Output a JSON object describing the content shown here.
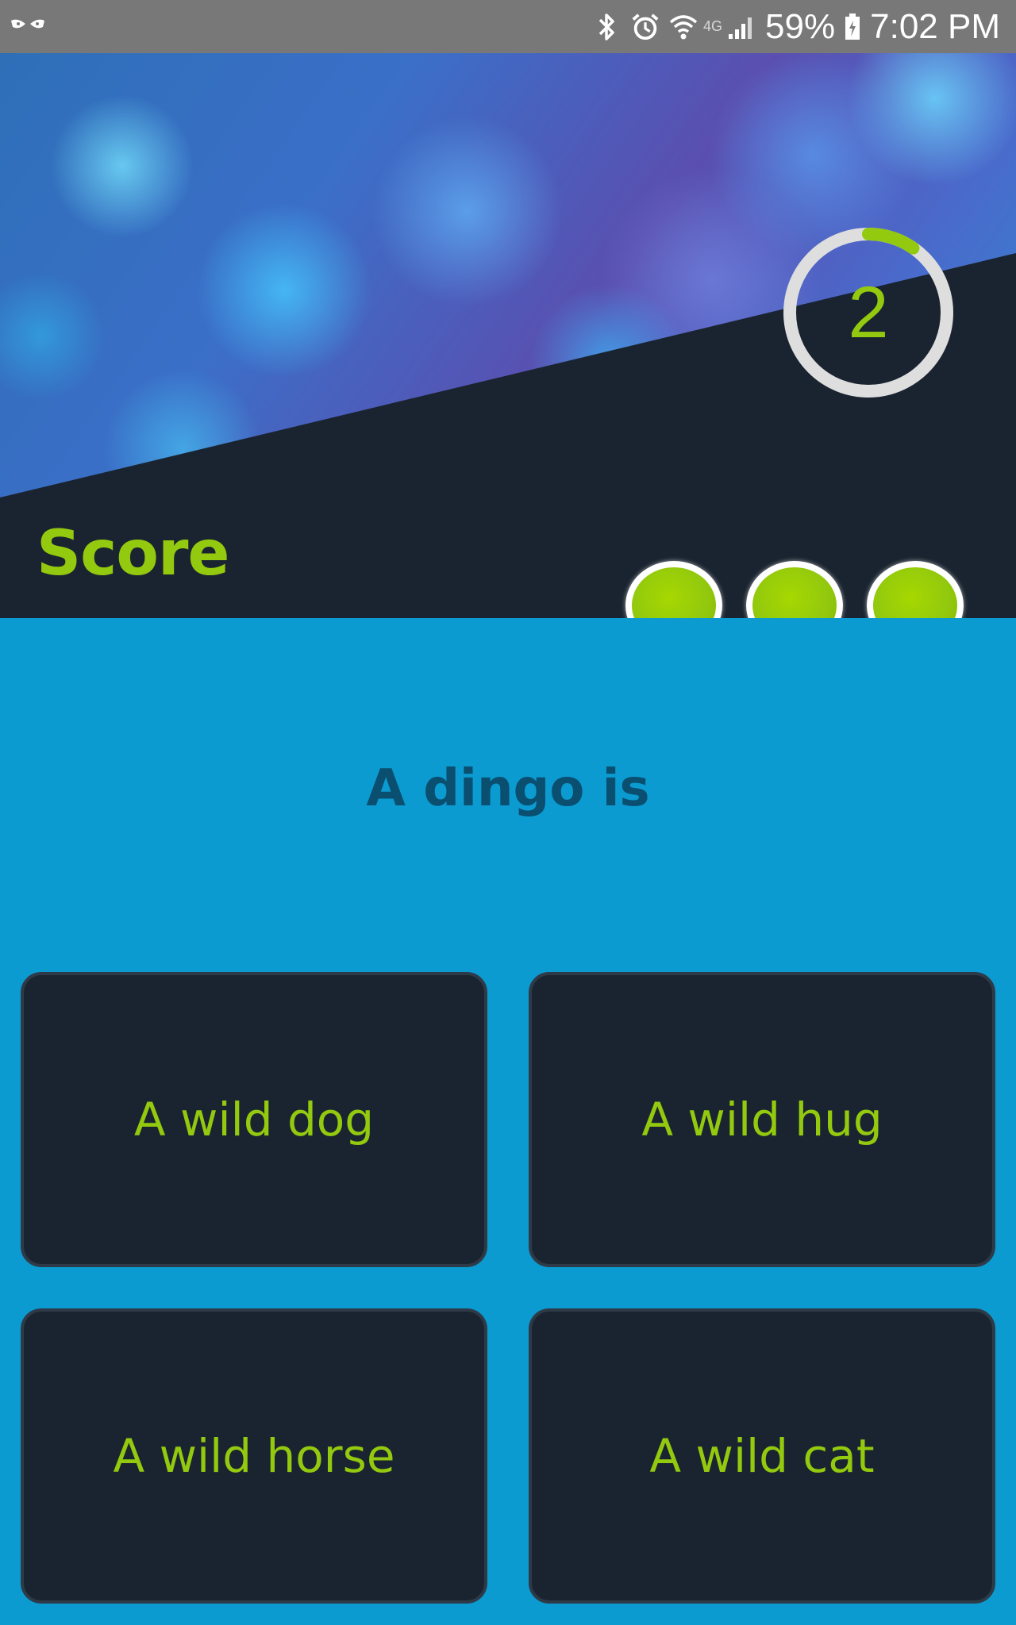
{
  "status_bar": {
    "network": "4G",
    "battery": "59%",
    "time": "7:02 PM",
    "icons": [
      "app-notification-icon",
      "bluetooth-icon",
      "alarm-icon",
      "wifi-icon",
      "signal-icon",
      "battery-icon"
    ]
  },
  "header": {
    "timer_value": "2",
    "score_label": "Score",
    "lives_remaining": 3
  },
  "question": {
    "text": "A dingo is"
  },
  "answers": [
    {
      "label": "A wild dog"
    },
    {
      "label": "A wild hug"
    },
    {
      "label": "A wild horse"
    },
    {
      "label": "A wild cat"
    }
  ],
  "colors": {
    "accent_green": "#93c90e",
    "dark_panel": "#1a2430",
    "question_bg": "#0b9bd0",
    "question_text": "#0a4e70"
  }
}
